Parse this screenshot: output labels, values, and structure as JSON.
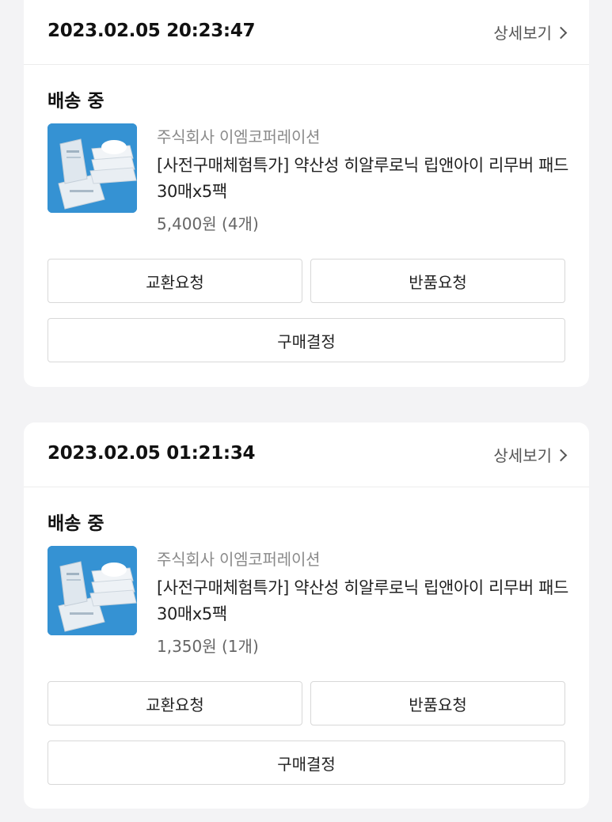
{
  "orders": [
    {
      "date": "2023.02.05 20:23:47",
      "detail_label": "상세보기",
      "status": "배송 중",
      "seller": "주식회사 이엠코퍼레이션",
      "product_name": "[사전구매체험특가] 약산성 히알루로닉 립앤아이 리무버 패드 30매x5팩",
      "price": "5,400원 (4개)",
      "buttons": {
        "exchange": "교환요청",
        "return": "반품요청",
        "confirm": "구매결정"
      }
    },
    {
      "date": "2023.02.05 01:21:34",
      "detail_label": "상세보기",
      "status": "배송 중",
      "seller": "주식회사 이엠코퍼레이션",
      "product_name": "[사전구매체험특가] 약산성 히알루로닉 립앤아이 리무버 패드 30매x5팩",
      "price": "1,350원 (1개)",
      "buttons": {
        "exchange": "교환요청",
        "return": "반품요청",
        "confirm": "구매결정"
      }
    }
  ],
  "colors": {
    "page_background": "#f3f3f5",
    "card_background": "#ffffff",
    "thumbnail_background": "#2f8fd1"
  },
  "icons": {
    "detail_arrow": "chevron-right-icon"
  }
}
